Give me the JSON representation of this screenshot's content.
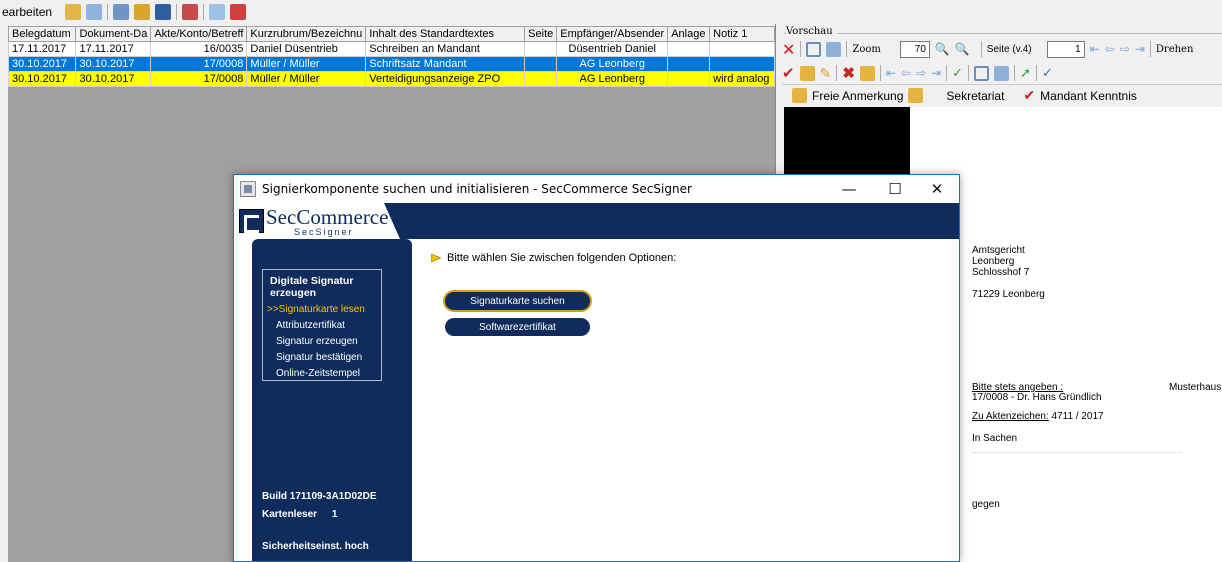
{
  "toolbar": {
    "menu_label": "earbeiten",
    "icons": [
      {
        "name": "edit-icon",
        "color": "#d9a62b"
      },
      {
        "name": "list-icon",
        "color": "#4f7fbf"
      },
      {
        "name": "search-docs-icon",
        "color": "#4f7fbf"
      },
      {
        "name": "stamp-icon",
        "color": "#d9a62b"
      },
      {
        "name": "document-icon",
        "color": "#2f5f9f"
      },
      {
        "name": "sign-icon",
        "color": "#3f6fbf"
      },
      {
        "name": "check-icon",
        "color": "#7fb0df"
      },
      {
        "name": "delete-icon",
        "color": "#cf3f3f"
      }
    ]
  },
  "grid": {
    "columns": [
      "Belegdatum",
      "Dokument-Da",
      "Akte/Konto/Betreff",
      "Kurzrubrum/Bezeichnu",
      "Inhalt des Standardtextes",
      "Seite",
      "Empfänger/Absender",
      "Anlage",
      "Notiz 1"
    ],
    "rows": [
      {
        "belegdatum": "17.11.2017",
        "dokument": "17.11.2017",
        "akte": "16/0035",
        "kurzrubrum": "Daniel Düsentrieb",
        "inhalt": "Schreiben an Mandant",
        "seite": "",
        "empfaenger": "Düsentrieb Daniel",
        "anlage": "",
        "notiz": ""
      },
      {
        "belegdatum": "30.10.2017",
        "dokument": "30.10.2017",
        "akte": "17/0008",
        "kurzrubrum": "Müller / Müller",
        "inhalt": "Schriftsatz Mandant",
        "seite": "",
        "empfaenger": "AG Leonberg",
        "anlage": "",
        "notiz": ""
      },
      {
        "belegdatum": "30.10.2017",
        "dokument": "30.10.2017",
        "akte": "17/0008",
        "kurzrubrum": "Müller / Müller",
        "inhalt": "Verteidigungsanzeige ZPO",
        "seite": "",
        "empfaenger": "AG Leonberg",
        "anlage": "",
        "notiz": "wird analog"
      }
    ]
  },
  "preview": {
    "header": "Vorschau",
    "zoom_label": "Zoom",
    "zoom_value": "70",
    "page_label": "Seite (v.4)",
    "page_value": "1",
    "rotate_label": "Drehen",
    "free_note_label": "Freie Anmerkung",
    "secretariat_label": "Sekretariat",
    "client_notice_label": "Mandant Kenntnis",
    "address": {
      "line1": "Amtsgericht",
      "line2": "Leonberg",
      "line3": "Schlosshof 7",
      "city": "71229 Leonberg"
    },
    "always_specify": "Bitte stets angeben :",
    "reference": "17/0008 - Dr. Hans Gründlich",
    "case_number_label": "Zu Aktenzeichen:",
    "case_number": "4711 / 2017",
    "in_matters": "In Sachen",
    "against": "gegen",
    "right_name": "Musterhaus"
  },
  "dialog": {
    "title": "Signierkomponente suchen und initialisieren  - SecCommerce SecSigner",
    "logo_text": "SecCommerce",
    "logo_sub": "SecSigner",
    "sidebar": {
      "heading": "Digitale Signatur erzeugen",
      "items": [
        {
          "label": ">>Signaturkarte lesen",
          "active": true
        },
        {
          "label": "Attributzertifikat",
          "active": false
        },
        {
          "label": "Signatur erzeugen",
          "active": false
        },
        {
          "label": "Signatur bestätigen",
          "active": false
        },
        {
          "label": "Online-Zeitstempel",
          "active": false
        }
      ],
      "build": "Build 171109-3A1D02DE",
      "card_reader_label": "Kartenleser",
      "card_reader_value": "1",
      "security": "Sicherheitseinst. hoch"
    },
    "prompt": "Bitte wählen Sie zwischen folgenden Optionen:",
    "buttons": {
      "search_card": "Signaturkarte suchen",
      "software_cert": "Softwarezertifikat"
    }
  }
}
